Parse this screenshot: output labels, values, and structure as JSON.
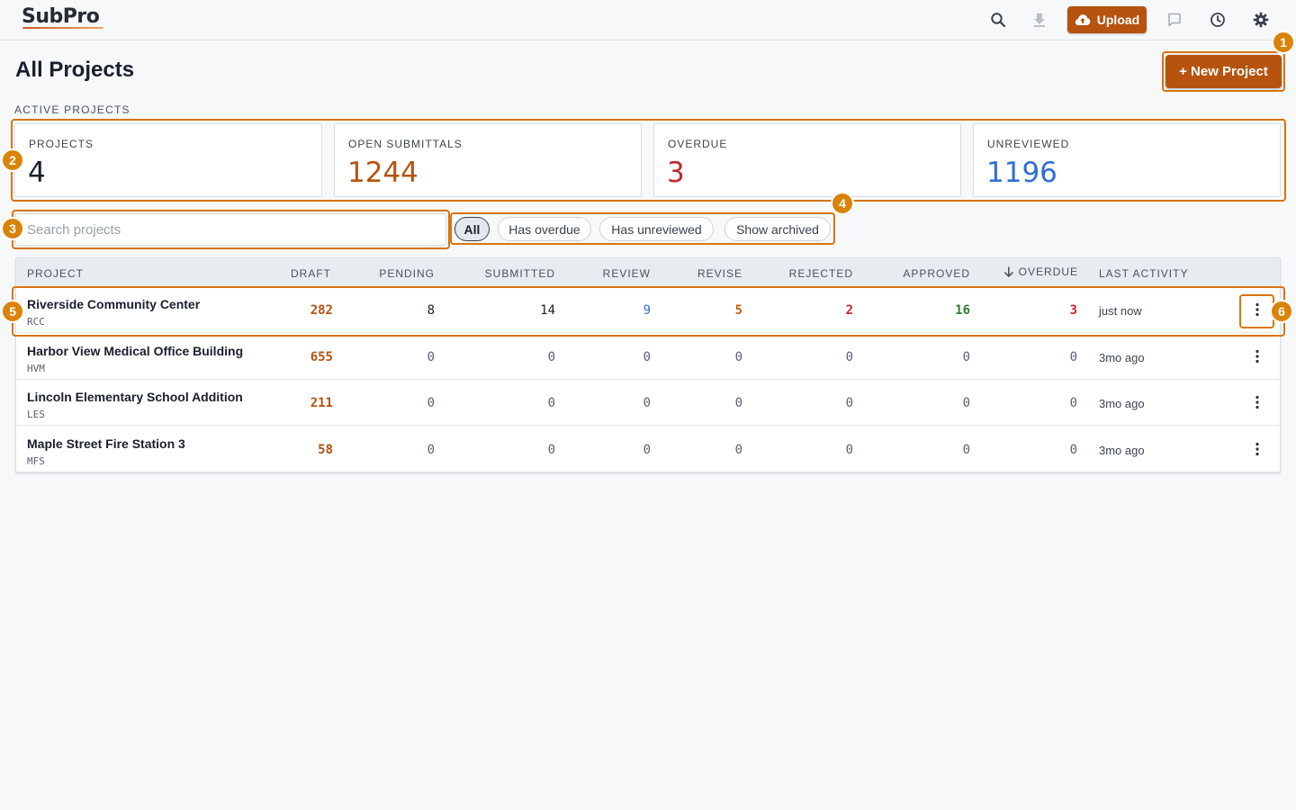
{
  "app": {
    "logo": "SubPro"
  },
  "toolbar": {
    "upload_label": "Upload",
    "icons": [
      "search-icon",
      "download-icon",
      "upload-cloud-icon",
      "comment-icon",
      "clock-icon",
      "gear-icon"
    ]
  },
  "header": {
    "title": "All Projects",
    "new_project_label": "+ New Project",
    "section_label": "ACTIVE PROJECTS"
  },
  "stats": [
    {
      "label": "PROJECTS",
      "value": "4",
      "color": "#1a1f2b"
    },
    {
      "label": "OPEN SUBMITTALS",
      "value": "1244",
      "color": "#b5530f"
    },
    {
      "label": "OVERDUE",
      "value": "3",
      "color": "#c0282d"
    },
    {
      "label": "UNREVIEWED",
      "value": "1196",
      "color": "#2f6fd6"
    }
  ],
  "search": {
    "placeholder": "Search projects",
    "value": ""
  },
  "filters": [
    "All",
    "Has overdue",
    "Has unreviewed",
    "Show archived"
  ],
  "active_filter": "All",
  "table": {
    "columns": [
      "PROJECT",
      "DRAFT",
      "PENDING",
      "SUBMITTED",
      "REVIEW",
      "REVISE",
      "REJECTED",
      "APPROVED",
      "OVERDUE",
      "LAST ACTIVITY"
    ],
    "sorted_column": "OVERDUE",
    "sort_direction": "descending",
    "rows": [
      {
        "name": "Riverside Community Center",
        "code": "RCC",
        "draft": "282",
        "pending": "8",
        "submitted": "14",
        "review": "9",
        "revise": "5",
        "rejected": "2",
        "approved": "16",
        "overdue": "3",
        "last_activity": "just now"
      },
      {
        "name": "Harbor View Medical Office Building",
        "code": "HVM",
        "draft": "655",
        "pending": "0",
        "submitted": "0",
        "review": "0",
        "revise": "0",
        "rejected": "0",
        "approved": "0",
        "overdue": "0",
        "last_activity": "3mo ago"
      },
      {
        "name": "Lincoln Elementary School Addition",
        "code": "LES",
        "draft": "211",
        "pending": "0",
        "submitted": "0",
        "review": "0",
        "revise": "0",
        "rejected": "0",
        "approved": "0",
        "overdue": "0",
        "last_activity": "3mo ago"
      },
      {
        "name": "Maple Street Fire Station 3",
        "code": "MFS",
        "draft": "58",
        "pending": "0",
        "submitted": "0",
        "review": "0",
        "revise": "0",
        "rejected": "0",
        "approved": "0",
        "overdue": "0",
        "last_activity": "3mo ago"
      }
    ]
  },
  "status_colors": {
    "draft": "#b5530f",
    "pending": "#1a1f2b",
    "submitted": "#1a1f2b",
    "review": "#2f6fd6",
    "revise": "#c2620a",
    "rejected": "#c0282d",
    "approved": "#2e7d32",
    "overdue": "#c0282d",
    "zero": "#5a6170"
  },
  "annotations": [
    "1",
    "2",
    "3",
    "4",
    "5",
    "6"
  ]
}
